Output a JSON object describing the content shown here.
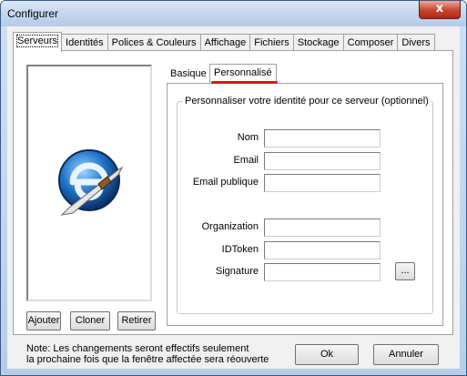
{
  "window": {
    "title": "Configurer",
    "close_label": "x"
  },
  "tabs": [
    {
      "label": "Serveurs"
    },
    {
      "label": "Identités"
    },
    {
      "label": "Polices & Couleurs"
    },
    {
      "label": "Affichage"
    },
    {
      "label": "Fichiers"
    },
    {
      "label": "Stockage"
    },
    {
      "label": "Composer"
    },
    {
      "label": "Divers"
    }
  ],
  "left": {
    "add_label": "Ajouter",
    "clone_label": "Cloner",
    "remove_label": "Retirer",
    "logo_icon": "server-logo-icon"
  },
  "subtabs": [
    {
      "label": "Basique"
    },
    {
      "label": "Personnalisé"
    }
  ],
  "group": {
    "title": "Personnaliser votre identité pour ce serveur (optionnel)",
    "fields": [
      {
        "label": "Nom",
        "value": ""
      },
      {
        "label": "Email",
        "value": ""
      },
      {
        "label": "Email publique",
        "value": ""
      },
      {
        "label": "Organization",
        "value": ""
      },
      {
        "label": "IDToken",
        "value": ""
      },
      {
        "label": "Signature",
        "value": ""
      }
    ],
    "browse_label": "..."
  },
  "footer": {
    "note_line1": "Note: Les changements seront effectifs seulement",
    "note_line2": "la prochaine fois que la fenêtre affectée sera réouverte",
    "ok_label": "Ok",
    "cancel_label": "Annuler"
  },
  "colors": {
    "highlight": "#e01010",
    "close": "#c7432c"
  }
}
